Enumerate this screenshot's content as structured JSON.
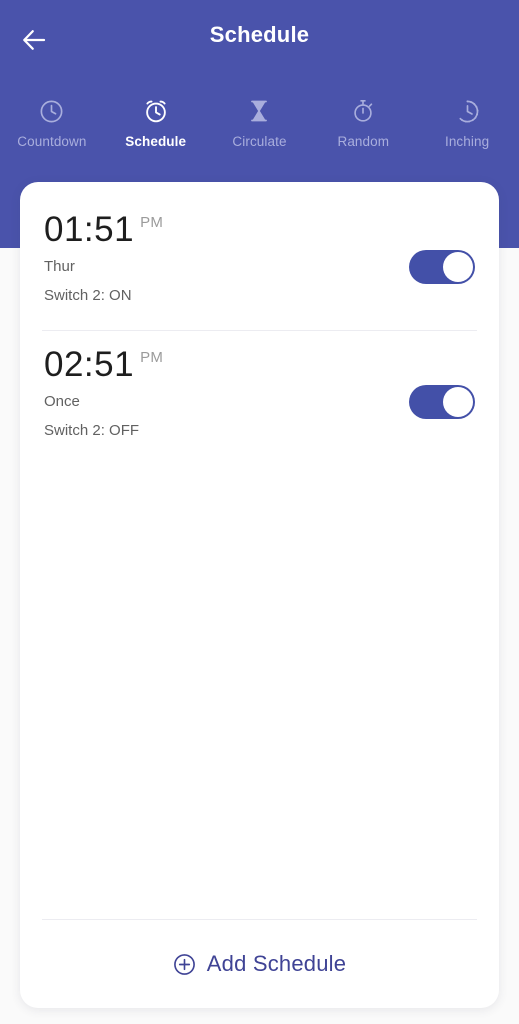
{
  "theme": {
    "header_bg": "#4a53ab",
    "page_bg": "#fafafa",
    "card_bg": "#ffffff",
    "accent": "#3f4395",
    "toggle_on": "#4350a8",
    "tab_inactive": "#a9aedd",
    "tab_active": "#ffffff",
    "divider": "#ececf1",
    "time_color": "#1e1e1e",
    "meta_color": "#616161",
    "meridiem_color": "#9b9b9b"
  },
  "appbar": {
    "title": "Schedule",
    "back_icon": "arrow-left-icon"
  },
  "tabs": [
    {
      "label": "Countdown",
      "icon": "clock-icon",
      "active": false
    },
    {
      "label": "Schedule",
      "icon": "alarm-clock-icon",
      "active": true
    },
    {
      "label": "Circulate",
      "icon": "hourglass-icon",
      "active": false
    },
    {
      "label": "Random",
      "icon": "stopwatch-icon",
      "active": false
    },
    {
      "label": "Inching",
      "icon": "dashed-clock-icon",
      "active": false
    }
  ],
  "schedules": [
    {
      "time": "01:51",
      "meridiem": "PM",
      "repeat": "Thur",
      "action": "Switch 2: ON",
      "enabled": true
    },
    {
      "time": "02:51",
      "meridiem": "PM",
      "repeat": "Once",
      "action": "Switch 2: OFF",
      "enabled": true
    }
  ],
  "footer": {
    "add_label": "Add Schedule",
    "add_icon": "plus-circle-icon"
  }
}
